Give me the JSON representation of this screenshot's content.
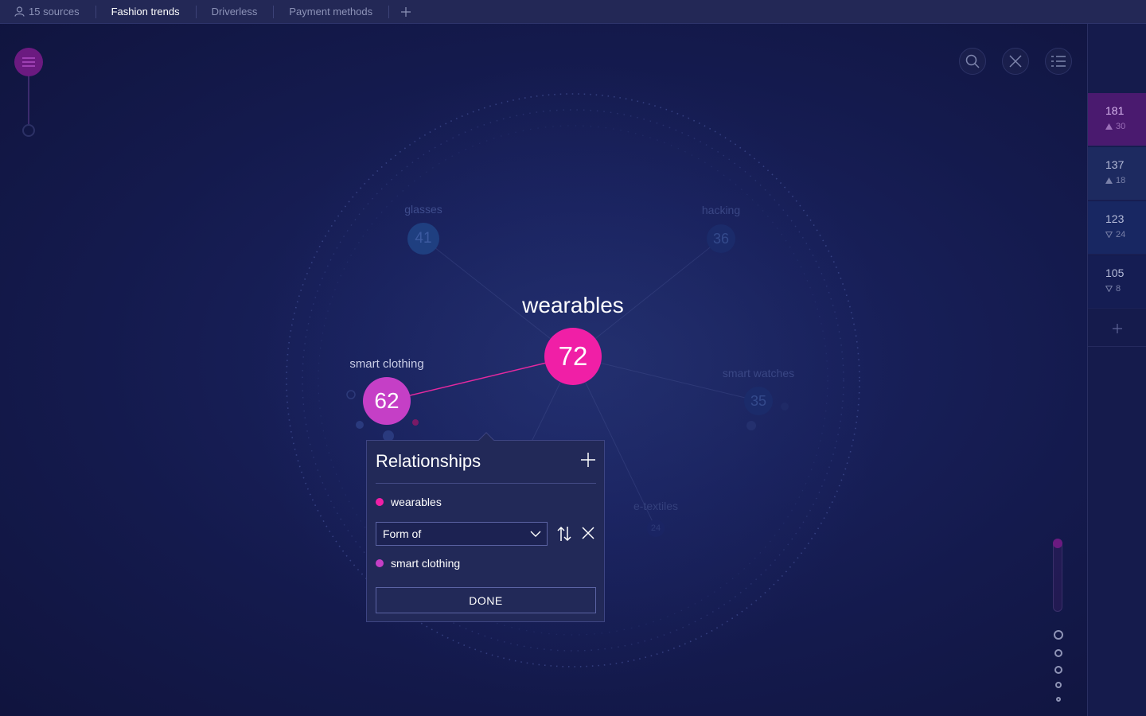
{
  "tabs": {
    "sources": "15 sources",
    "items": [
      "Fashion trends",
      "Driverless",
      "Payment methods"
    ],
    "active_index": 0,
    "add_icon": "plus-icon"
  },
  "toolbar": {
    "menu_icon": "hamburger-icon",
    "search_icon": "search-icon",
    "close_icon": "close-icon",
    "list_icon": "list-icon",
    "trend_icon": "trend-icon"
  },
  "stats": [
    {
      "value": "181",
      "delta": "30",
      "direction": "up"
    },
    {
      "value": "137",
      "delta": "18",
      "direction": "up"
    },
    {
      "value": "123",
      "delta": "24",
      "direction": "down"
    },
    {
      "value": "105",
      "delta": "8",
      "direction": "down"
    }
  ],
  "graph": {
    "center": {
      "label": "wearables",
      "value": "72",
      "color": "#f01fa6"
    },
    "selected": {
      "label": "smart clothing",
      "value": "62",
      "color": "#c53fc6"
    },
    "others": [
      {
        "label": "glasses",
        "value": "41"
      },
      {
        "label": "hacking",
        "value": "36"
      },
      {
        "label": "smart watches",
        "value": "35"
      },
      {
        "label": "e-textiles",
        "value": "24"
      }
    ],
    "edge_color": "#e5299f"
  },
  "popup": {
    "title": "Relationships",
    "source": {
      "label": "wearables",
      "color": "#f01fa6"
    },
    "relation": "Form of",
    "target": {
      "label": "smart clothing",
      "color": "#c53fc6"
    },
    "done": "DONE"
  }
}
